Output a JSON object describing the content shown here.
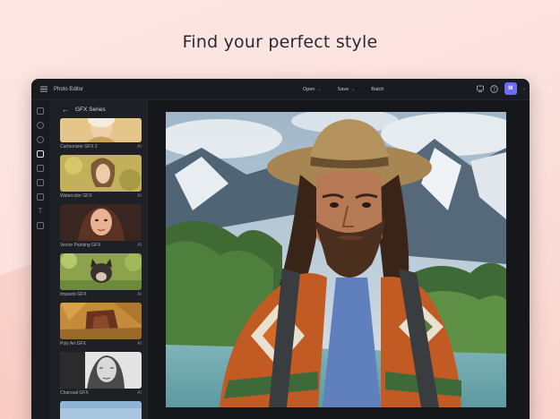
{
  "headline": "Find your perfect style",
  "app": {
    "title": "Photo Editor"
  },
  "toolbar": {
    "open_label": "Open",
    "save_label": "Save",
    "batch_label": "Batch"
  },
  "user": {
    "avatar_initial": "M"
  },
  "panel": {
    "title": "GFX Series",
    "items": [
      {
        "label": "Cartoonizer GFX 2",
        "tag": "AI"
      },
      {
        "label": "Watercolor GFX",
        "tag": "AI"
      },
      {
        "label": "Vector Painting GFX",
        "tag": "AI"
      },
      {
        "label": "Impasto GFX",
        "tag": "AI"
      },
      {
        "label": "Poly Art GFX",
        "tag": "AI"
      },
      {
        "label": "Charcoal GFX",
        "tag": "AI"
      }
    ]
  },
  "icons": {
    "menu": "hamburger-icon",
    "rail": [
      "layers-icon",
      "adjust-icon",
      "effects-icon",
      "styles-icon",
      "crop-icon",
      "retouch-icon",
      "frame-icon",
      "text-icon",
      "overlay-icon"
    ],
    "top_right": [
      "compare-icon",
      "help-icon"
    ]
  },
  "colors": {
    "accent": "#6b6cf0",
    "window_bg": "#1c1d22",
    "page_bg": "#fde7e3"
  }
}
